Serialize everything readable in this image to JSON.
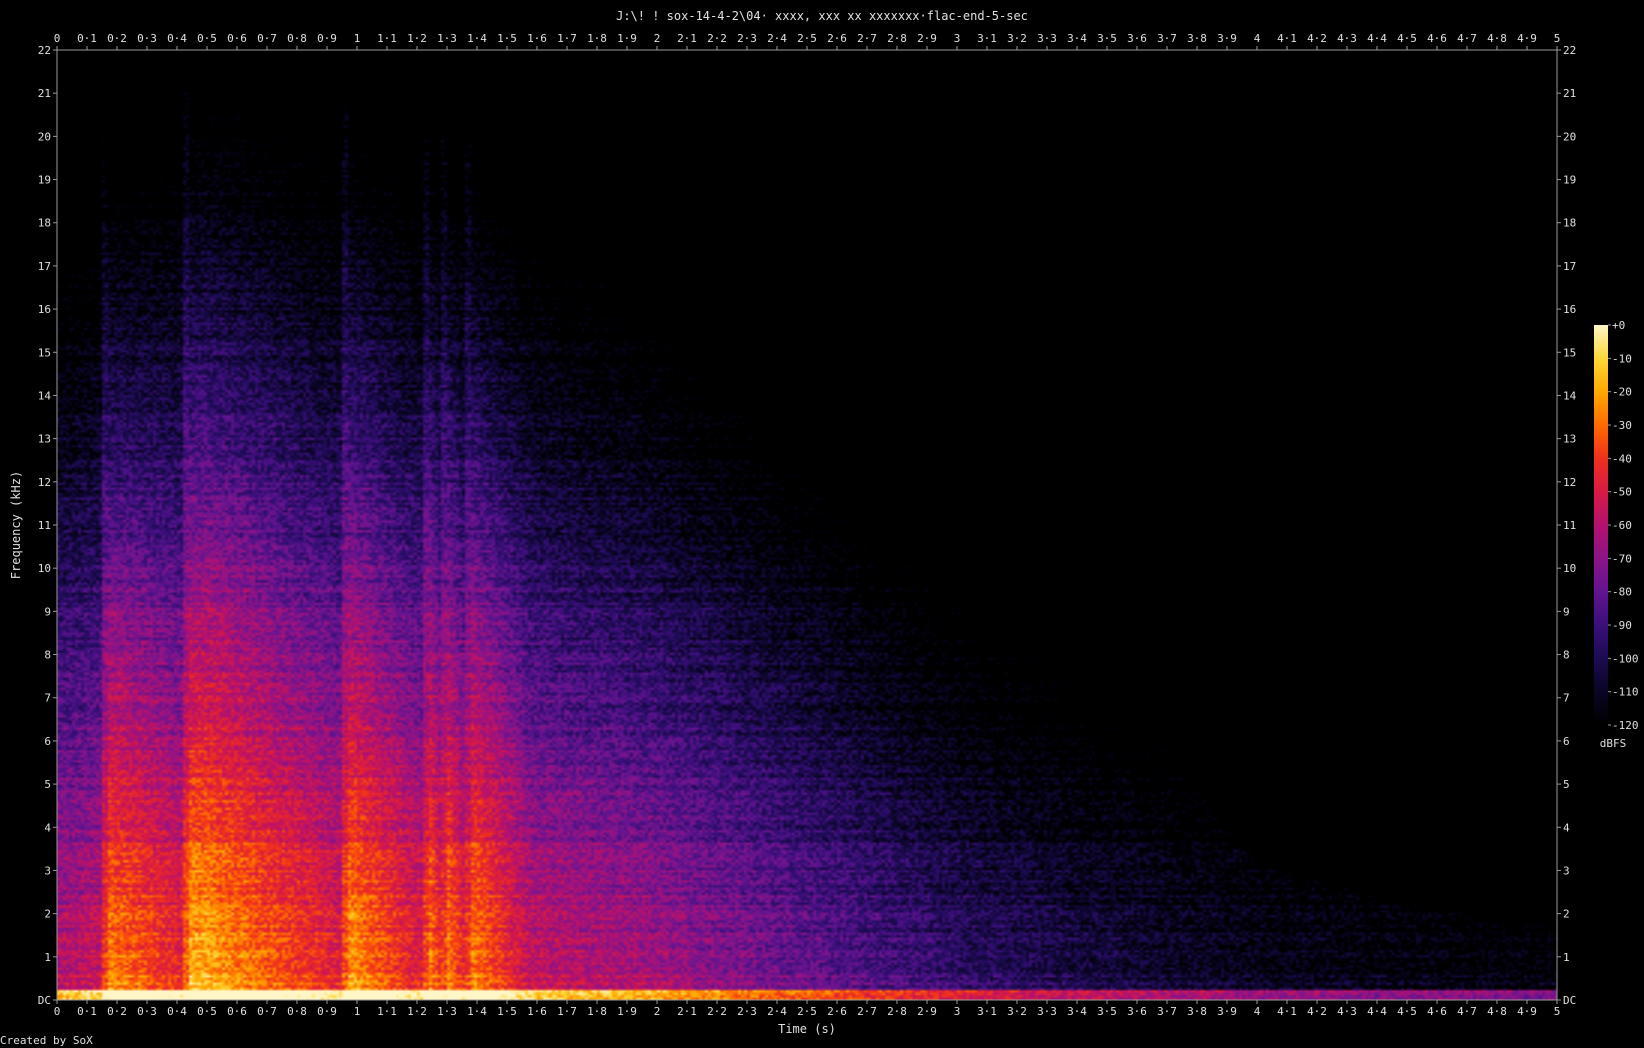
{
  "chart_data": {
    "type": "heatmap",
    "title": "J:\\! ! sox-14-4-2\\04· xxxx, xxx xx xxxxxxx·flac-end-5-sec",
    "xlabel": "Time (s)",
    "ylabel": "Frequency (kHz)",
    "x_ticks": [
      "0",
      "0·1",
      "0·2",
      "0·3",
      "0·4",
      "0·5",
      "0·6",
      "0·7",
      "0·8",
      "0·9",
      "1",
      "1·1",
      "1·2",
      "1·3",
      "1·4",
      "1·5",
      "1·6",
      "1·7",
      "1·8",
      "1·9",
      "2",
      "2·1",
      "2·2",
      "2·3",
      "2·4",
      "2·5",
      "2·6",
      "2·7",
      "2·8",
      "2·9",
      "3",
      "3·1",
      "3·2",
      "3·3",
      "3·4",
      "3·5",
      "3·6",
      "3·7",
      "3·8",
      "3·9",
      "4",
      "4·1",
      "4·2",
      "4·3",
      "4·4",
      "4·5",
      "4·6",
      "4·7",
      "4·8",
      "4·9",
      "5"
    ],
    "y_ticks": [
      "DC",
      "1",
      "2",
      "3",
      "4",
      "5",
      "6",
      "7",
      "8",
      "9",
      "10",
      "11",
      "12",
      "13",
      "14",
      "15",
      "16",
      "17",
      "18",
      "19",
      "20",
      "21",
      "22"
    ],
    "xlim": [
      0,
      5
    ],
    "ylim": [
      0,
      22
    ],
    "colorbar": {
      "label": "dBFS",
      "ticks": [
        "+0",
        "-10",
        "-20",
        "-30",
        "-40",
        "-50",
        "-60",
        "-70",
        "-80",
        "-90",
        "-100",
        "-110",
        "-120"
      ],
      "range": [
        -120,
        0
      ],
      "colors": [
        "#000000",
        "#0a0524",
        "#1c0b52",
        "#3a0f7a",
        "#621490",
        "#8c1488",
        "#b5116e",
        "#d81a45",
        "#f0301c",
        "#ff6a00",
        "#ffa800",
        "#ffd838",
        "#fff6c8"
      ]
    },
    "onset_times": [
      0.17,
      0.44,
      0.97,
      1.24,
      1.3,
      1.38
    ],
    "onset_decay_s": [
      0.27,
      0.53,
      0.27,
      0.06,
      0.08,
      0.2
    ],
    "decay_to_floor_time": 4.0,
    "energy_profile": [
      {
        "t": 0.0,
        "max_khz": 20.5,
        "level_db": -55
      },
      {
        "t": 0.5,
        "max_khz": 21.0,
        "level_db": -40
      },
      {
        "t": 1.0,
        "max_khz": 20.5,
        "level_db": -45
      },
      {
        "t": 1.5,
        "max_khz": 19.5,
        "level_db": -50
      },
      {
        "t": 2.0,
        "max_khz": 17.0,
        "level_db": -60
      },
      {
        "t": 2.5,
        "max_khz": 15.0,
        "level_db": -75
      },
      {
        "t": 3.0,
        "max_khz": 12.0,
        "level_db": -90
      },
      {
        "t": 3.5,
        "max_khz": 7.5,
        "level_db": -100
      },
      {
        "t": 4.0,
        "max_khz": 3.0,
        "level_db": -108
      },
      {
        "t": 4.5,
        "max_khz": 2.0,
        "level_db": -112
      },
      {
        "t": 5.0,
        "max_khz": 1.5,
        "level_db": -115
      }
    ]
  },
  "footer": {
    "credit": "Created by SoX"
  }
}
